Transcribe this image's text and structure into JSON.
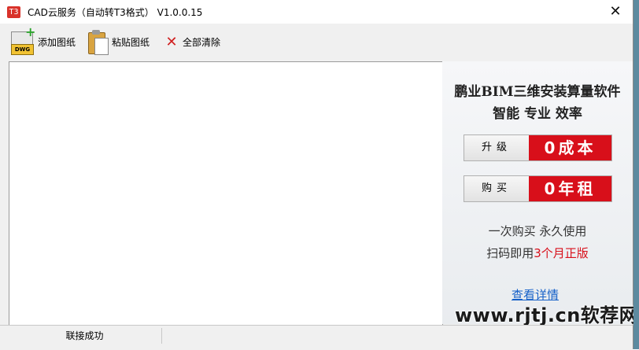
{
  "window": {
    "icon_text": "T3",
    "title": "CAD云服务（自动转T3格式） V1.0.0.15",
    "close_glyph": "✕"
  },
  "toolbar": {
    "add_label": "添加图纸",
    "add_icon": "dwg-add-icon",
    "add_icon_tag": "DWG",
    "paste_label": "粘贴图纸",
    "paste_icon": "clipboard-icon",
    "clear_label": "全部清除",
    "clear_icon": "red-x-icon"
  },
  "ad": {
    "headline1": "鹏业BIM三维安装算量软件",
    "headline2": "智能 专业 效率",
    "promo_upgrade": {
      "left": "升级",
      "right": "0成本"
    },
    "promo_buy": {
      "left": "购买",
      "right": "0年租"
    },
    "line1": "一次购买 永久使用",
    "line2_prefix": "扫码即用",
    "line2_highlight": "3个月正版",
    "link": "查看详情",
    "accent_color": "#d80f1a",
    "link_color": "#1560c8"
  },
  "watermark": "www.rjtj.cn软荐网",
  "status": {
    "text": "联接成功"
  }
}
